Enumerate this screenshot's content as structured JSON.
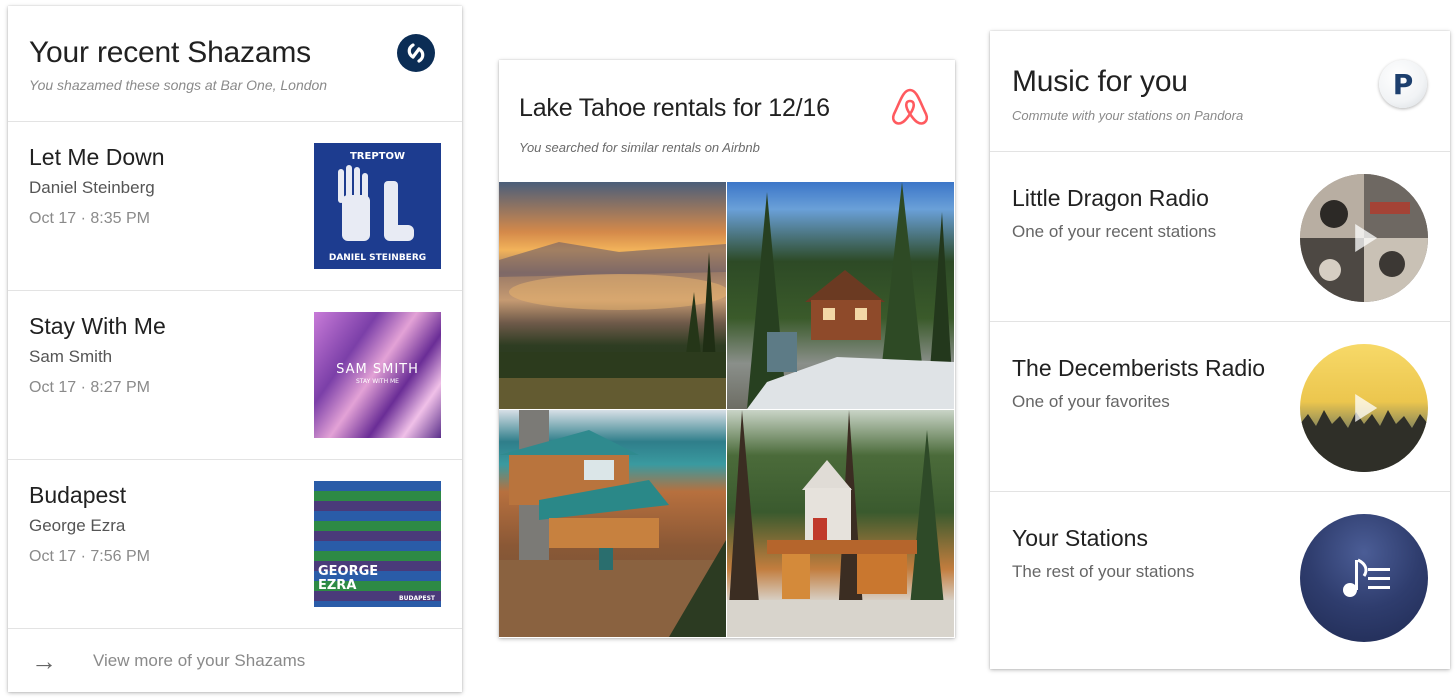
{
  "shazam": {
    "title": "Your recent Shazams",
    "subtitle": "You shazamed these songs at Bar One, London",
    "logo_icon": "shazam-logo",
    "songs": [
      {
        "title": "Let Me Down",
        "artist": "Daniel Steinberg",
        "date": "Oct 17 · 8:35 PM",
        "art_top": "TREPTOW",
        "art_bottom": "DANIEL STEINBERG"
      },
      {
        "title": "Stay With Me",
        "artist": "Sam Smith",
        "date": "Oct 17 · 8:27 PM",
        "art_top": "SAM SMITH",
        "art_bottom": "STAY WITH ME"
      },
      {
        "title": "Budapest",
        "artist": "George Ezra",
        "date": "Oct 17 · 7:56 PM",
        "art_top": "GEORGE EZRA",
        "art_bottom": "BUDAPEST"
      }
    ],
    "more_label": "View more of your Shazams"
  },
  "airbnb": {
    "title": "Lake Tahoe rentals for 12/16",
    "subtitle": "You searched for similar rentals on Airbnb",
    "logo_icon": "airbnb-logo",
    "brand_color": "#ff5a5f"
  },
  "pandora": {
    "title": "Music for you",
    "subtitle": "Commute with your stations on Pandora",
    "logo_letter": "P",
    "stations": [
      {
        "name": "Little Dragon Radio",
        "detail": "One of your recent stations"
      },
      {
        "name": "The Decemberists Radio",
        "detail": "One of your favorites"
      },
      {
        "name": "Your Stations",
        "detail": "The rest of your stations"
      }
    ]
  }
}
